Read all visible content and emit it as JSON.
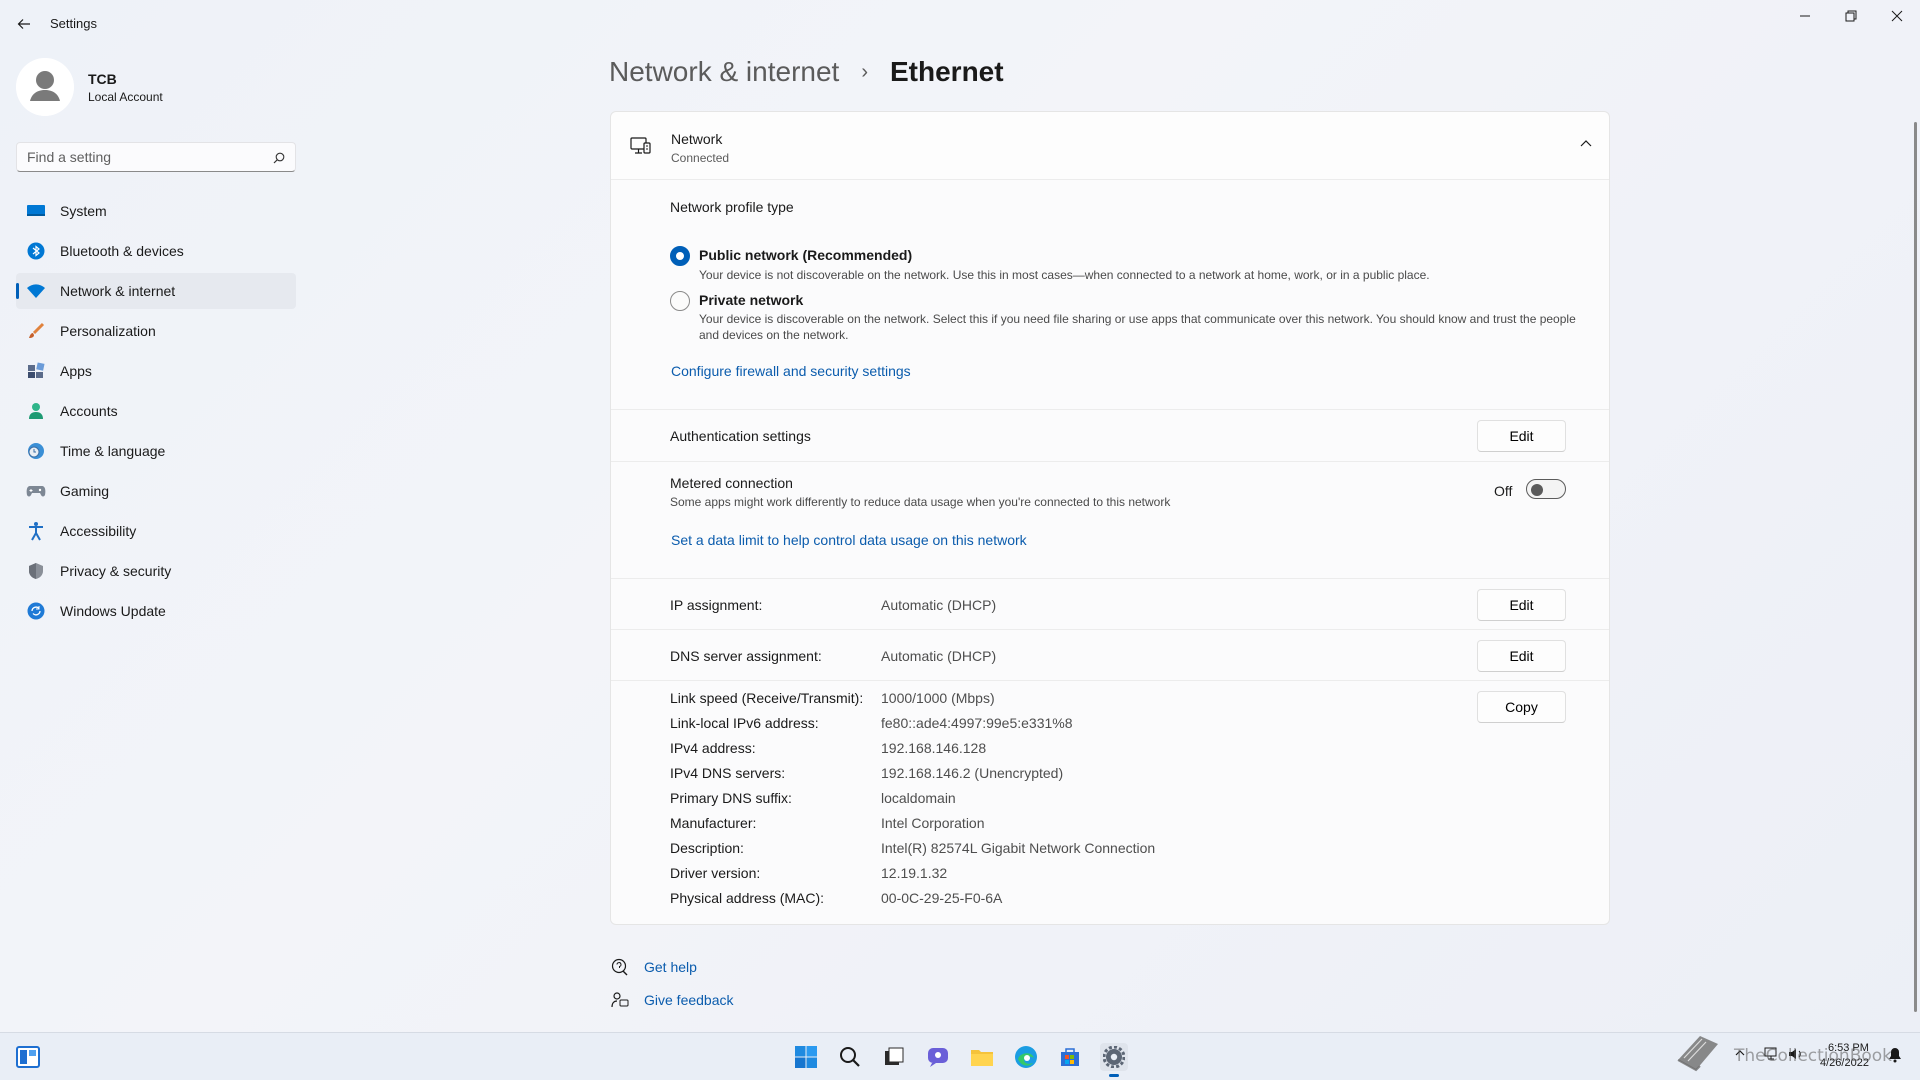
{
  "window": {
    "title": "Settings"
  },
  "user": {
    "name": "TCB",
    "account_type": "Local Account"
  },
  "search": {
    "placeholder": "Find a setting"
  },
  "sidebar": {
    "items": [
      {
        "label": "System",
        "icon": "system-icon"
      },
      {
        "label": "Bluetooth & devices",
        "icon": "bluetooth-icon"
      },
      {
        "label": "Network & internet",
        "icon": "wifi-icon",
        "active": true
      },
      {
        "label": "Personalization",
        "icon": "brush-icon"
      },
      {
        "label": "Apps",
        "icon": "apps-icon"
      },
      {
        "label": "Accounts",
        "icon": "account-icon"
      },
      {
        "label": "Time & language",
        "icon": "globe-clock-icon"
      },
      {
        "label": "Gaming",
        "icon": "controller-icon"
      },
      {
        "label": "Accessibility",
        "icon": "accessibility-icon"
      },
      {
        "label": "Privacy & security",
        "icon": "shield-icon"
      },
      {
        "label": "Windows Update",
        "icon": "update-icon"
      }
    ]
  },
  "breadcrumb": {
    "parent": "Network & internet",
    "separator": "›",
    "current": "Ethernet"
  },
  "network": {
    "title": "Network",
    "status": "Connected",
    "profile_heading": "Network profile type",
    "public": {
      "label": "Public network (Recommended)",
      "description": "Your device is not discoverable on the network. Use this in most cases—when connected to a network at home, work, or in a public place.",
      "selected": true
    },
    "private": {
      "label": "Private network",
      "description": "Your device is discoverable on the network. Select this if you need file sharing or use apps that communicate over this network. You should know and trust the people and devices on the network.",
      "selected": false
    },
    "firewall_link": "Configure firewall and security settings",
    "auth": {
      "label": "Authentication settings",
      "button": "Edit"
    },
    "metered": {
      "label": "Metered connection",
      "description": "Some apps might work differently to reduce data usage when you're connected to this network",
      "state": "Off",
      "link": "Set a data limit to help control data usage on this network"
    },
    "ip_assignment": {
      "label": "IP assignment:",
      "value": "Automatic (DHCP)",
      "button": "Edit"
    },
    "dns_assignment": {
      "label": "DNS server assignment:",
      "value": "Automatic (DHCP)",
      "button": "Edit"
    },
    "copy_button": "Copy",
    "properties": [
      {
        "key": "Link speed (Receive/Transmit):",
        "value": "1000/1000 (Mbps)"
      },
      {
        "key": "Link-local IPv6 address:",
        "value": "fe80::ade4:4997:99e5:e331%8"
      },
      {
        "key": "IPv4 address:",
        "value": "192.168.146.128"
      },
      {
        "key": "IPv4 DNS servers:",
        "value": "192.168.146.2 (Unencrypted)"
      },
      {
        "key": "Primary DNS suffix:",
        "value": "localdomain"
      },
      {
        "key": "Manufacturer:",
        "value": "Intel Corporation"
      },
      {
        "key": "Description:",
        "value": "Intel(R) 82574L Gigabit Network Connection"
      },
      {
        "key": "Driver version:",
        "value": "12.19.1.32"
      },
      {
        "key": "Physical address (MAC):",
        "value": "00-0C-29-25-F0-6A"
      }
    ]
  },
  "help": {
    "get_help": "Get help",
    "give_feedback": "Give feedback"
  },
  "taskbar": {
    "time": "6:53 PM",
    "date": "4/26/2022",
    "watermark": "TheCollectionBook",
    "accent": "#005fb8"
  }
}
